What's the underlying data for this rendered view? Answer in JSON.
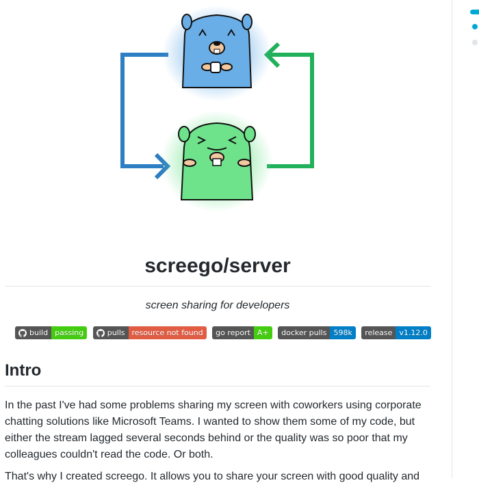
{
  "colors": {
    "accent": "#00a8d6",
    "arrow_blue": "#2d7ec2",
    "arrow_green": "#20b15a",
    "gopher_blue": "#6aaee8",
    "gopher_green": "#6ee38b",
    "text": "#24292e",
    "rule": "#e1e4e8"
  },
  "hero": {
    "image": "screego-logo",
    "icons": [
      "gopher-blue-icon",
      "gopher-green-icon",
      "arrow-left-icon",
      "arrow-right-icon"
    ]
  },
  "title": "screego/server",
  "tagline": "screen sharing for developers",
  "badges": [
    {
      "name": "build-badge",
      "label": "build",
      "value": "passing",
      "color": "#44cc11",
      "github_icon": true
    },
    {
      "name": "pulls-badge",
      "label": "pulls",
      "value": "resource not found",
      "color": "#e05d44",
      "github_icon": true
    },
    {
      "name": "goreport-badge",
      "label": "go report",
      "value": "A+",
      "color": "#44cc11",
      "github_icon": false
    },
    {
      "name": "docker-pulls-badge",
      "label": "docker pulls",
      "value": "598k",
      "color": "#007ec6",
      "github_icon": false
    },
    {
      "name": "release-badge",
      "label": "release",
      "value": "v1.12.0",
      "color": "#007ec6",
      "github_icon": false
    }
  ],
  "intro": {
    "heading": "Intro",
    "paragraph": "In the past I've had some problems sharing my screen with coworkers using corporate chatting solutions like Microsoft Teams. I wanted to show them some of my code, but either the stream lagged several seconds behind or the quality was so poor that my colleagues couldn't read the code. Or both.",
    "paragraph2": "That's why I created screego. It allows you to share your screen with good quality and"
  },
  "sidebar": {
    "toc_icons": [
      "toc-active-bar",
      "toc-dot-active",
      "toc-dot-inactive"
    ]
  }
}
